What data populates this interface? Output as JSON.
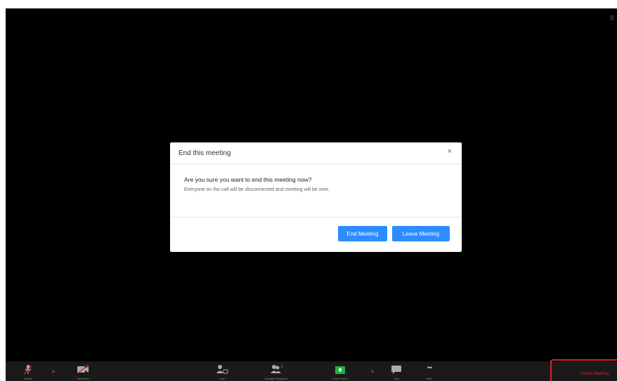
{
  "dialog": {
    "title": "End this meeting",
    "close_glyph": "×",
    "question": "Are you sure you want to end this meeting now?",
    "note": "Everyone on the call will be disconnected and meeting will be over.",
    "end_button": "End Meeting",
    "leave_button": "Leave Meeting"
  },
  "toolbar": {
    "items": [
      {
        "label": "Unmute",
        "icon": "mic-muted-icon"
      },
      {
        "label": "Start Video",
        "icon": "video-off-icon"
      },
      {
        "label": "Invite",
        "icon": "invite-icon"
      },
      {
        "label": "Manage Participants",
        "icon": "participants-icon"
      },
      {
        "label": "Share Screen",
        "icon": "share-screen-icon"
      },
      {
        "label": "Chat",
        "icon": "chat-icon"
      },
      {
        "label": "More",
        "icon": "more-icon"
      }
    ],
    "leave_label": "Leave Meeting",
    "caret_glyph": "^",
    "more_glyph": "•••"
  },
  "colors": {
    "primary_button": "#2d8cff",
    "leave_red": "#e02020",
    "share_green": "#1fb141",
    "background": "#000000"
  }
}
